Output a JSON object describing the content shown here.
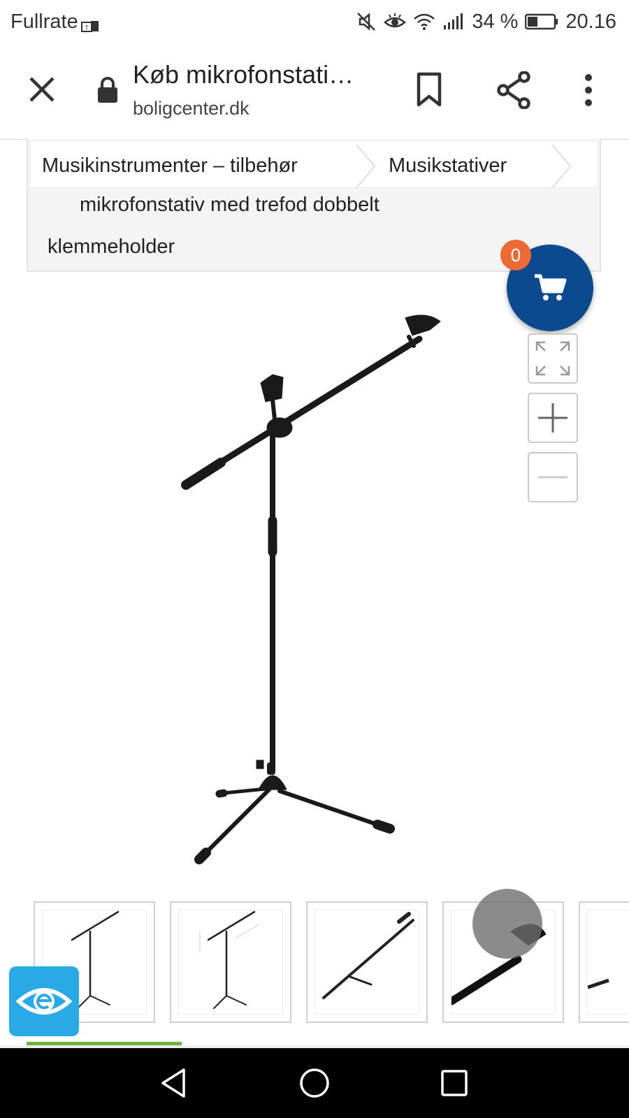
{
  "status_bar": {
    "carrier": "Fullrate",
    "battery": "34 %",
    "time": "20.16",
    "icons": [
      "carrier-badge-icon",
      "mute-icon",
      "eye-comfort-icon",
      "wifi-icon",
      "signal-icon",
      "battery-icon"
    ]
  },
  "toolbar": {
    "title": "Køb mikrofonstati…",
    "domain": "boligcenter.dk",
    "icons": [
      "close-icon",
      "lock-icon",
      "bookmark-icon",
      "share-icon",
      "more-vert-icon"
    ]
  },
  "breadcrumb": {
    "items": [
      "Musikinstrumenter – tilbehør",
      "Musikstativer"
    ],
    "current_line1": "mikrofonstativ med trefod dobbelt",
    "current_line2": "klemmeholder"
  },
  "cart": {
    "count": "0",
    "color": "#0b4a8f",
    "badge_color": "#ee6a35"
  },
  "zoom_controls": [
    "fullscreen-icon",
    "zoom-in-icon",
    "zoom-out-icon"
  ],
  "colors": {
    "reader_badge": "#29a9e6",
    "progress_green": "#6cb33f"
  }
}
